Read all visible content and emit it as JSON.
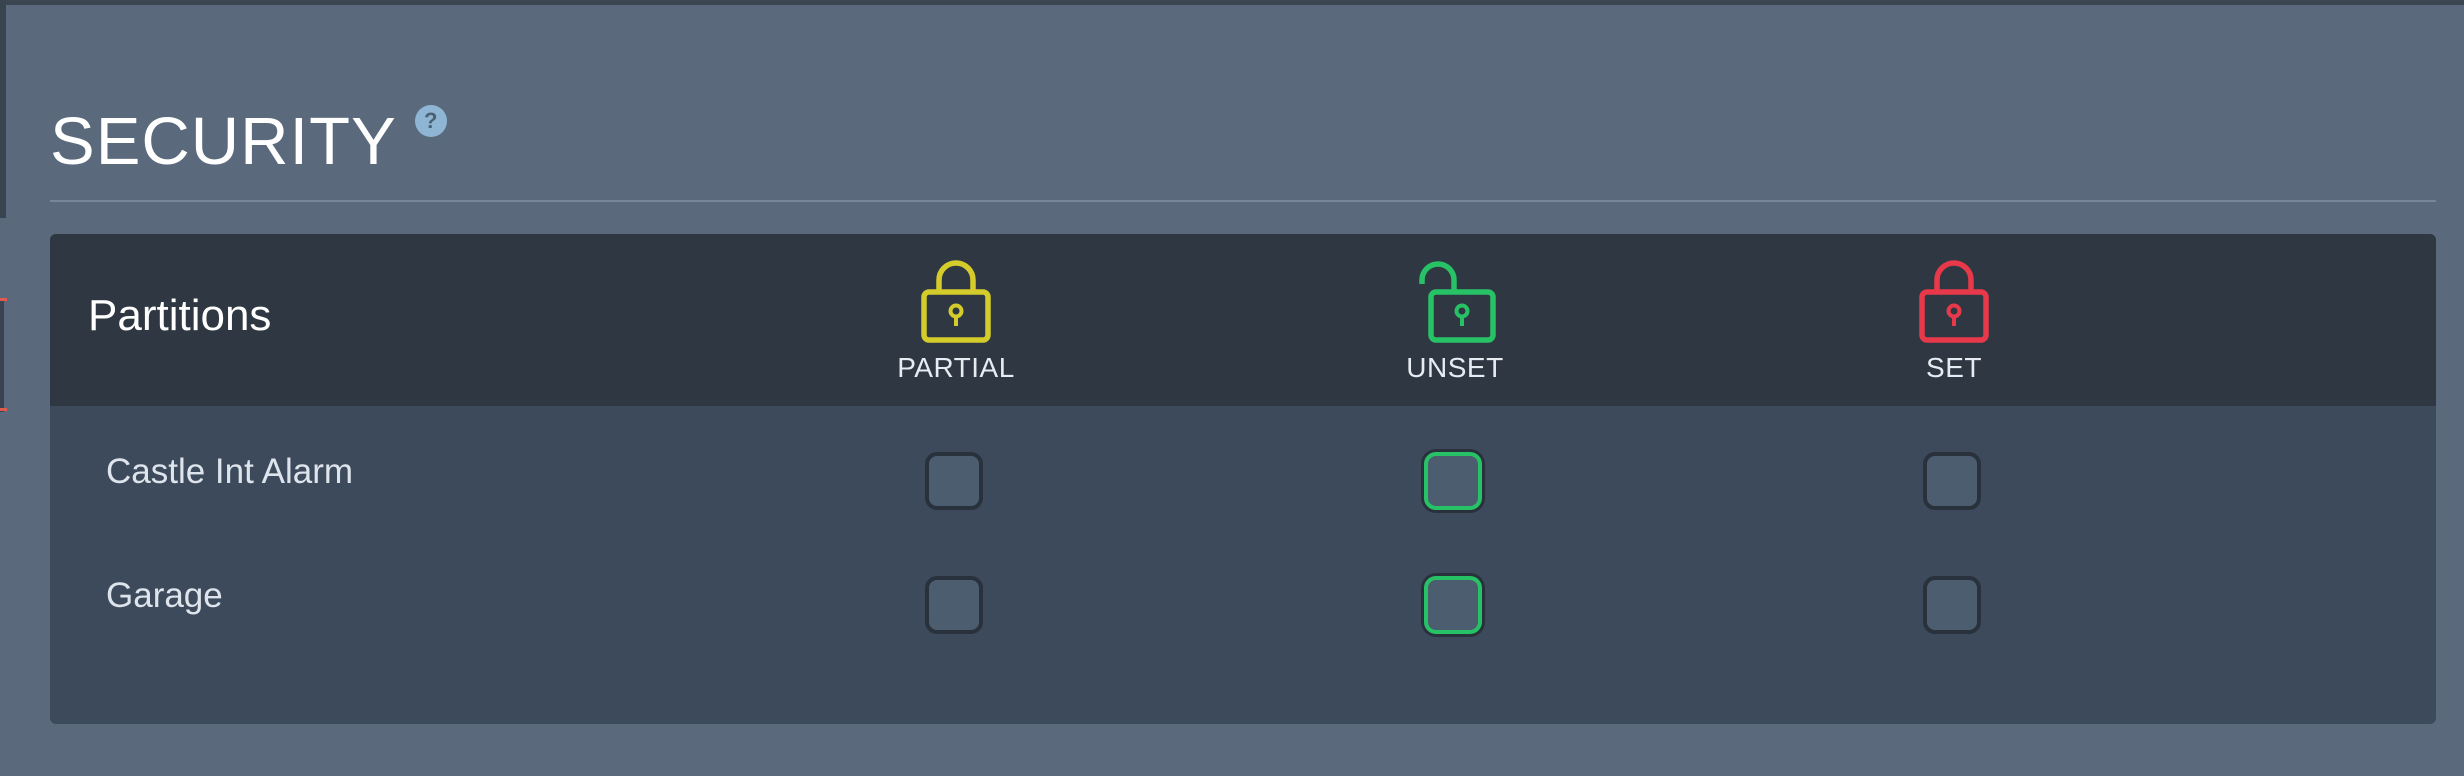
{
  "page": {
    "title": "SECURITY",
    "help_glyph": "?"
  },
  "partitions": {
    "title": "Partitions",
    "columns": [
      {
        "label": "PARTIAL",
        "icon": "locked-padlock-icon",
        "color": "#d4cc2a"
      },
      {
        "label": "UNSET",
        "icon": "unlocked-padlock-icon",
        "color": "#27c266"
      },
      {
        "label": "SET",
        "icon": "locked-padlock-icon",
        "color": "#e8394a"
      }
    ],
    "rows": [
      {
        "name": "Castle Int Alarm",
        "selected": "UNSET"
      },
      {
        "name": "Garage",
        "selected": "UNSET"
      }
    ]
  },
  "colors": {
    "background": "#5a6a7c",
    "panel_header": "#2e3742",
    "panel_body": "#3d4a5b",
    "selected_border": "#27c266"
  }
}
